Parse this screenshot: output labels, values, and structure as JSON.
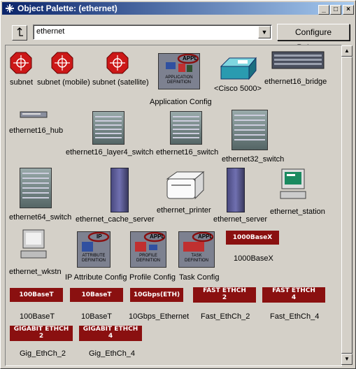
{
  "window": {
    "title": "Object Palette: (ethernet)",
    "buttons": [
      "_",
      "□",
      "×"
    ]
  },
  "toolbar": {
    "filter_value": "ethernet",
    "configure_label": "Configure Palette..."
  },
  "items": [
    {
      "label": "subnet"
    },
    {
      "label": "subnet (mobile)"
    },
    {
      "label": "subnet (satellite)"
    },
    {
      "label": "Application Config",
      "icon_tag": "APPL",
      "icon_sub": "APPLICATION DEFINITION"
    },
    {
      "label": "<Cisco 5000>"
    },
    {
      "label": "ethernet16_bridge"
    },
    {
      "label": "ethernet16_hub"
    },
    {
      "label": "ethernet16_layer4_switch"
    },
    {
      "label": "ethernet16_switch"
    },
    {
      "label": "ethernet32_switch"
    },
    {
      "label": "ethernet64_switch"
    },
    {
      "label": "ethernet_cache_server"
    },
    {
      "label": "ethernet_printer"
    },
    {
      "label": "ethernet_server"
    },
    {
      "label": "ethernet_station"
    },
    {
      "label": "ethernet_wkstn"
    },
    {
      "label": "IP Attribute Config",
      "icon_tag": "IP",
      "icon_sub": "ATTRIBUTE DEFINITION"
    },
    {
      "label": "Profile Config",
      "icon_tag": "APPL",
      "icon_sub": "PROFILE DEFINITION"
    },
    {
      "label": "Task Config",
      "icon_tag": "APPL",
      "icon_sub": "TASK DEFINITION"
    },
    {
      "label": "1000BaseX",
      "icon_tag": "1000BaseX"
    },
    {
      "label": "100BaseT",
      "icon_tag": "100BaseT"
    },
    {
      "label": "10BaseT",
      "icon_tag": "10BaseT"
    },
    {
      "label": "10Gbps_Ethernet",
      "icon_tag": "10Gbps(ETH)"
    },
    {
      "label": "Fast_EthCh_2",
      "icon_tag": "FAST ETHCH",
      "icon_num": "2"
    },
    {
      "label": "Fast_EthCh_4",
      "icon_tag": "FAST ETHCH",
      "icon_num": "4"
    },
    {
      "label": "Gig_EthCh_2",
      "icon_tag": "GIGABIT ETHCH",
      "icon_num": "2"
    },
    {
      "label": "Gig_EthCh_4",
      "icon_tag": "GIGABIT ETHCH",
      "icon_num": "4"
    }
  ],
  "colors": {
    "link_badge": "#8a1010",
    "subnet": "#cc1818",
    "title_bar": "#0a246a"
  }
}
